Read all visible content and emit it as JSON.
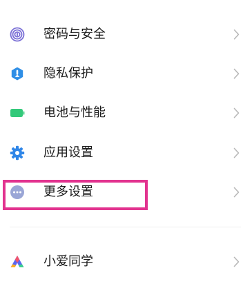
{
  "settings": {
    "items": [
      {
        "label": "密码与安全",
        "icon": "fingerprint-icon",
        "icon_color": "#7a6fd6"
      },
      {
        "label": "隐私保护",
        "icon": "privacy-shield-icon",
        "icon_color": "#2e8ee6"
      },
      {
        "label": "电池与性能",
        "icon": "battery-icon",
        "icon_color": "#33c97a"
      },
      {
        "label": "应用设置",
        "icon": "gear-icon",
        "icon_color": "#2f86e8"
      },
      {
        "label": "更多设置",
        "icon": "more-dots-icon",
        "icon_color": "#9aa6d6"
      },
      {
        "label": "小爱同学",
        "icon": "xiaoai-icon",
        "icon_color": "#5a67f0"
      }
    ]
  },
  "colors": {
    "highlight": "#e2338f",
    "chevron": "#b8b8b8",
    "divider": "#eeeeee"
  }
}
